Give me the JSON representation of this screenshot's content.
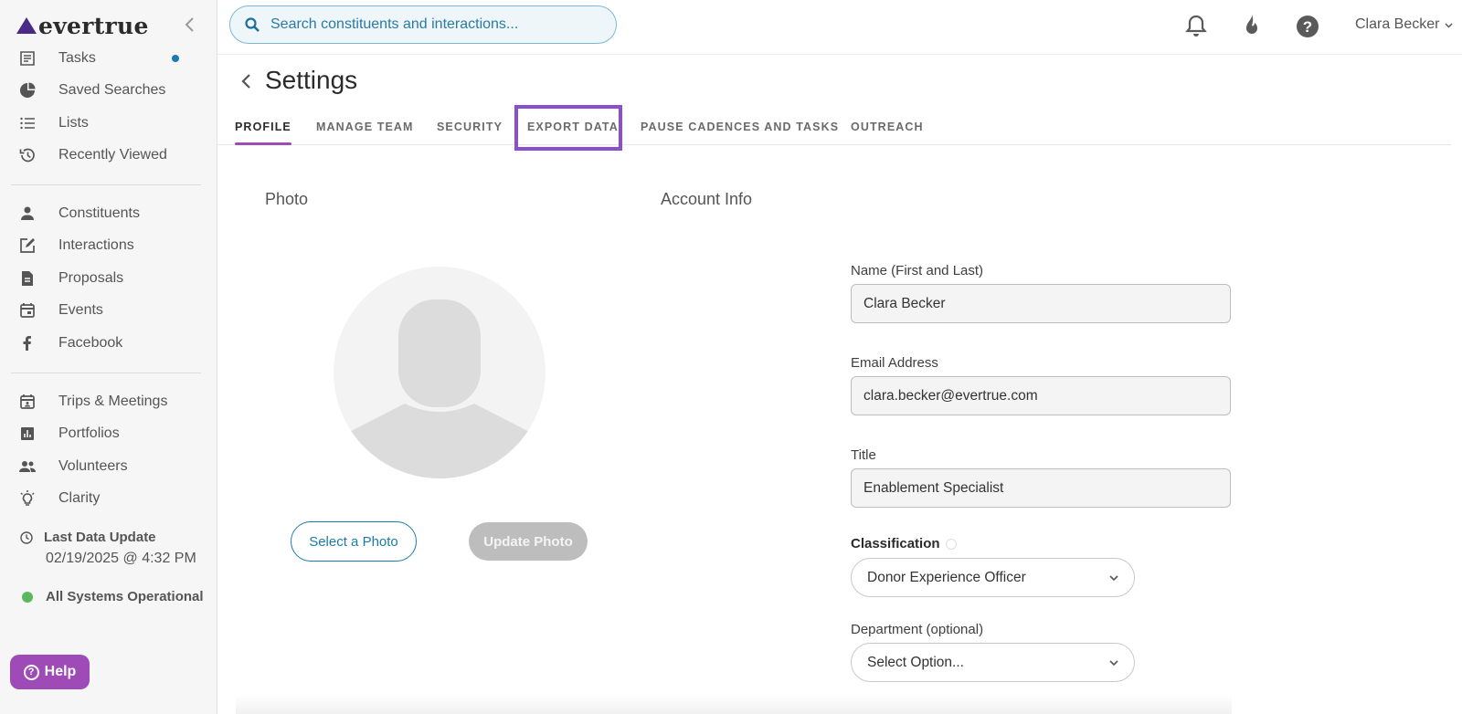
{
  "app": {
    "logo_text": "evertrue",
    "brand_color": "#4a2a86",
    "accent_color": "#9e4bb8",
    "link_color": "#1b7cab"
  },
  "sidebar": {
    "group1": [
      {
        "label": "Tasks",
        "icon": "tasks-icon",
        "has_dot": true
      },
      {
        "label": "Saved Searches",
        "icon": "pie-chart-icon"
      },
      {
        "label": "Lists",
        "icon": "list-icon"
      },
      {
        "label": "Recently Viewed",
        "icon": "history-icon"
      }
    ],
    "group2": [
      {
        "label": "Constituents",
        "icon": "person-icon"
      },
      {
        "label": "Interactions",
        "icon": "edit-note-icon"
      },
      {
        "label": "Proposals",
        "icon": "document-icon"
      },
      {
        "label": "Events",
        "icon": "calendar-icon"
      },
      {
        "label": "Facebook",
        "icon": "facebook-icon"
      }
    ],
    "group3": [
      {
        "label": "Trips & Meetings",
        "icon": "calendar-person-icon"
      },
      {
        "label": "Portfolios",
        "icon": "bar-chart-icon"
      },
      {
        "label": "Volunteers",
        "icon": "people-icon"
      },
      {
        "label": "Clarity",
        "icon": "lightbulb-icon"
      }
    ],
    "last_update_label": "Last Data Update",
    "last_update_value": "02/19/2025 @ 4:32 PM",
    "systems_status": "All Systems Operational",
    "help_label": "Help"
  },
  "header": {
    "search_placeholder": "Search constituents and interactions...",
    "user_name": "Clara Becker"
  },
  "page": {
    "title": "Settings",
    "tabs": [
      {
        "label": "PROFILE",
        "active": true
      },
      {
        "label": "MANAGE TEAM"
      },
      {
        "label": "SECURITY"
      },
      {
        "label": "EXPORT DATA",
        "highlighted": true
      },
      {
        "label": "PAUSE CADENCES AND TASKS"
      },
      {
        "label": "OUTREACH"
      }
    ],
    "photo_section_title": "Photo",
    "account_section_title": "Account Info",
    "select_photo_label": "Select a Photo",
    "update_photo_label": "Update Photo",
    "fields": {
      "name_label": "Name (First and Last)",
      "name_value": "Clara Becker",
      "email_label": "Email Address",
      "email_value": "clara.becker@evertrue.com",
      "title_label": "Title",
      "title_value": "Enablement Specialist",
      "classification_label": "Classification",
      "classification_value": "Donor Experience Officer",
      "department_label": "Department (optional)",
      "department_value": "Select Option..."
    }
  }
}
